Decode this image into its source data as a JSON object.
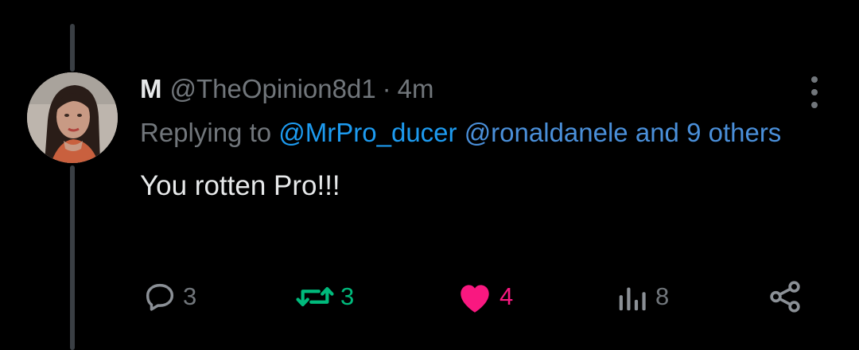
{
  "tweet": {
    "display_name": "M",
    "handle": "@TheOpinion8d1",
    "separator": "·",
    "time": "4m",
    "replying_prefix": "Replying to",
    "mentions": [
      "@MrPro_ducer",
      "@ronaldanele"
    ],
    "mentions_more": "and 9 others",
    "text": "You rotten Pro!!!"
  },
  "actions": {
    "replies": "3",
    "retweets": "3",
    "likes": "4",
    "views": "8"
  },
  "icons": {
    "reply": "reply-icon",
    "retweet": "retweet-icon",
    "like": "heart-icon",
    "views": "views-icon",
    "share": "share-icon",
    "more": "more-dots-icon"
  },
  "colors": {
    "background": "#000000",
    "text": "#e7e9ea",
    "muted": "#71767b",
    "link": "#1d9bf0",
    "retweet": "#00ba7c",
    "like": "#f91880"
  }
}
